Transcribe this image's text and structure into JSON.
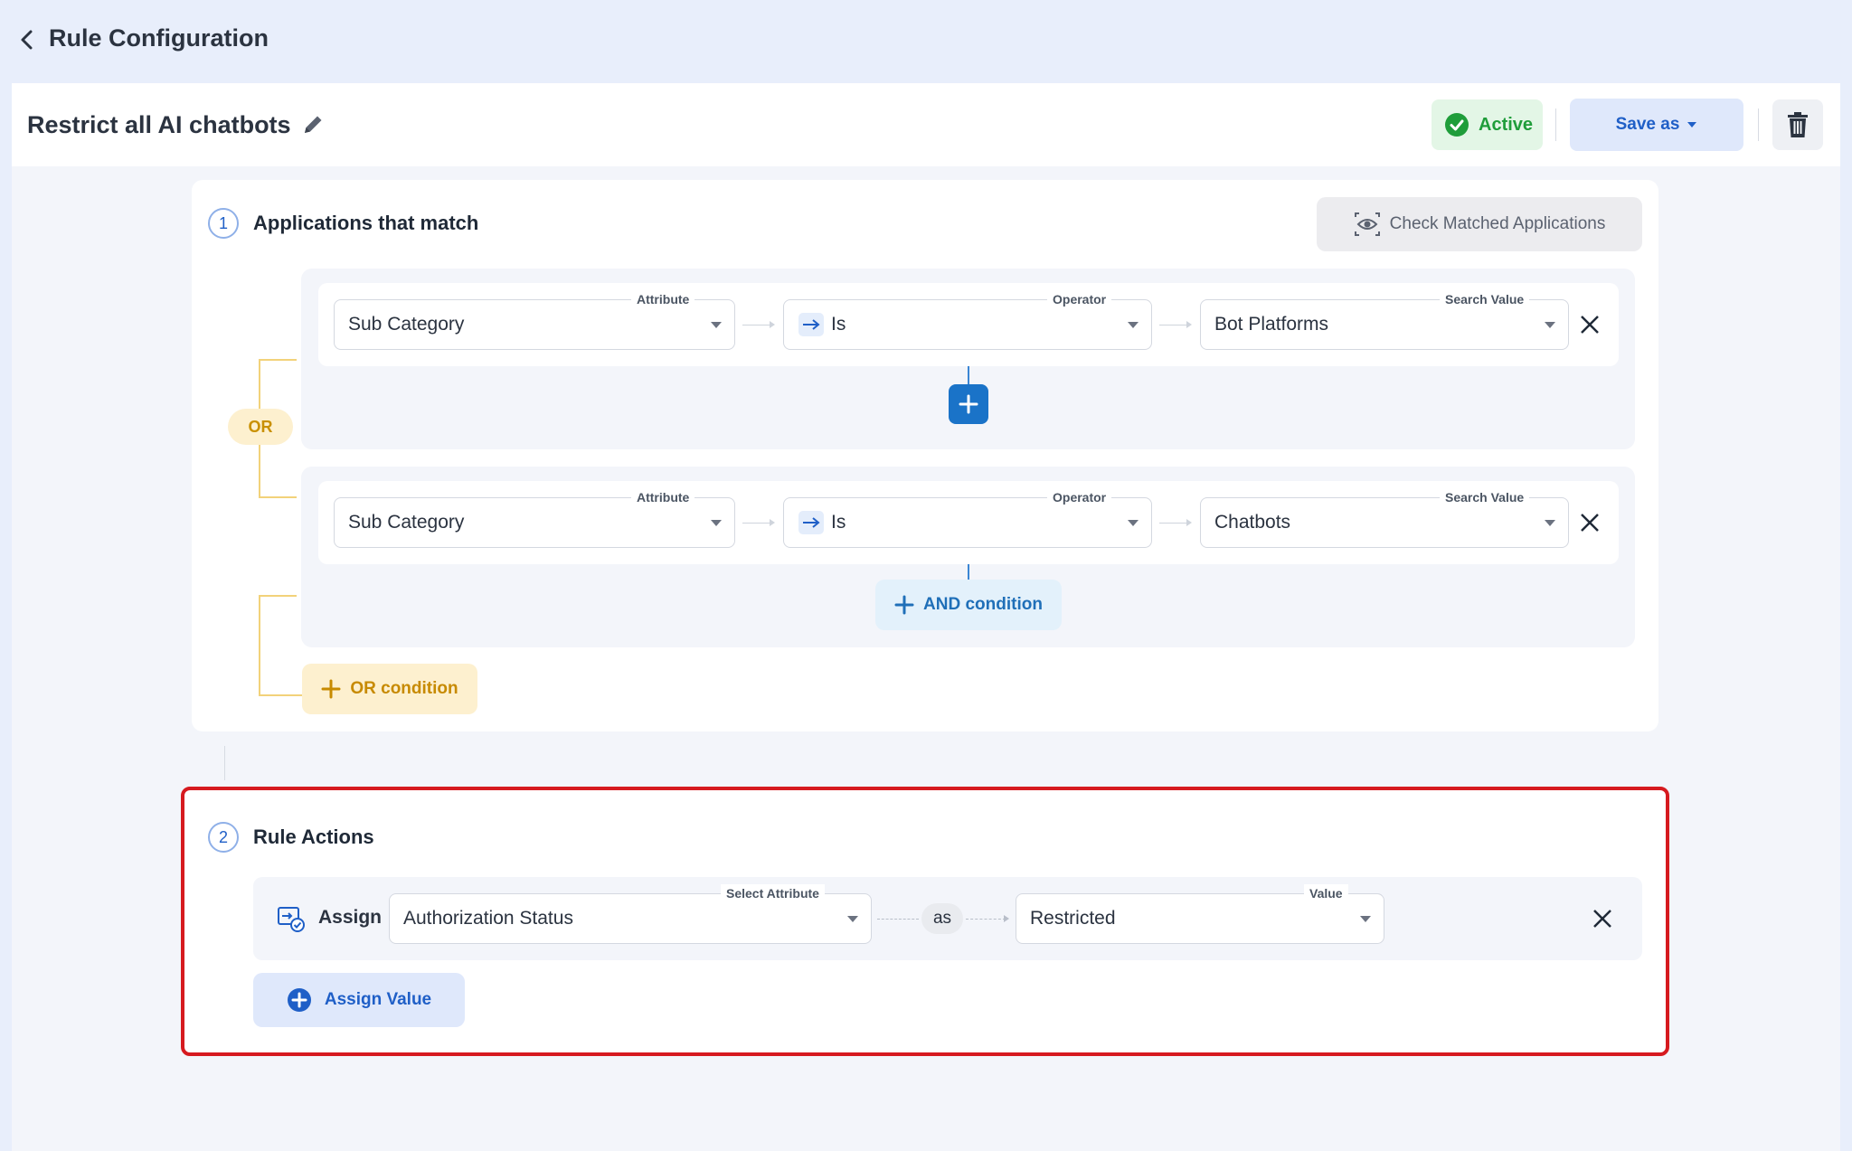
{
  "header": {
    "title": "Rule Configuration"
  },
  "rule": {
    "name": "Restrict all AI chatbots",
    "status_label": "Active",
    "save_label": "Save as"
  },
  "section1": {
    "number": "1",
    "title": "Applications that match",
    "check_button_label": "Check Matched Applications",
    "or_badge": "OR",
    "or_condition_label": "OR condition",
    "and_condition_label": "AND condition",
    "conditions": [
      {
        "attribute_legend": "Attribute",
        "attribute": "Sub Category",
        "operator_legend": "Operator",
        "operator": "Is",
        "value_legend": "Search Value",
        "value": "Bot Platforms"
      },
      {
        "attribute_legend": "Attribute",
        "attribute": "Sub Category",
        "operator_legend": "Operator",
        "operator": "Is",
        "value_legend": "Search Value",
        "value": "Chatbots"
      }
    ]
  },
  "section2": {
    "number": "2",
    "title": "Rule Actions",
    "action": {
      "verb": "Assign",
      "attribute_legend": "Select Attribute",
      "attribute": "Authorization Status",
      "joiner": "as",
      "value_legend": "Value",
      "value": "Restricted"
    },
    "assign_value_label": "Assign Value"
  },
  "colors": {
    "accent": "#1f5fc7",
    "active": "#1f9d3a",
    "or_color": "#c99000",
    "highlight_border": "#d61a1f"
  },
  "icons": [
    "chevron-left-icon",
    "pencil-icon",
    "check-circle-icon",
    "caret-down-icon",
    "trash-icon",
    "eye-icon",
    "arrow-right-icon",
    "close-icon",
    "plus-icon",
    "assign-icon"
  ]
}
